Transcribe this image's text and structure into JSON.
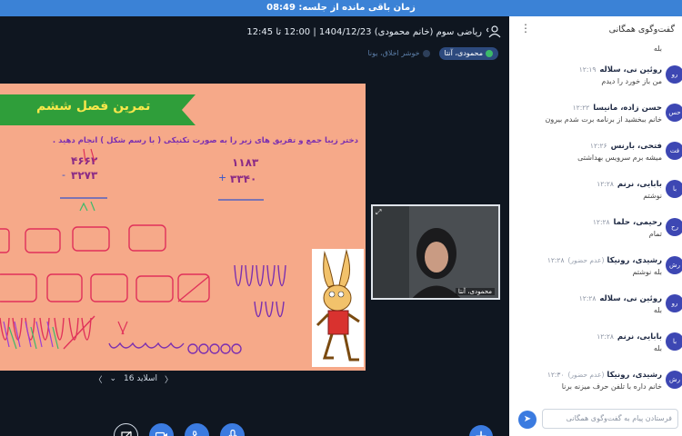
{
  "topbar": {
    "text": "زمان باقی مانده از جلسه: 08:49"
  },
  "session": {
    "title": "ریاضی سوم (خانم محمودی) 1404/12/23 | 12:00 تا 12:45",
    "user_icon": "user-settings-icon"
  },
  "chips": [
    {
      "label": "محمودی، آنتا",
      "state": "active",
      "icon": "mic-icon"
    },
    {
      "label": "خوشر اخلاق، یونا",
      "state": "muted",
      "icon": "avatar-icon"
    }
  ],
  "slide": {
    "banner": "تمرین فصل ششم",
    "instruction": "دختر زیبا جمع و تفریق های زیر را به صورت تکنیکی ( با رسم شکل ) انجام دهید .",
    "sub_top": "۴۶۶۲",
    "sub_bottom": "۳۲۷۳",
    "add_top": "۱۱۸۳",
    "add_bottom": "۳۳۴۰",
    "nav_label": "اسلاید 16"
  },
  "webcam": {
    "name": "محمودی، آنتا"
  },
  "chat": {
    "title": "گفت‌وگوی همگانی",
    "input_placeholder": "فرستادن پیام به گفت‌وگوی همگانی",
    "messages": [
      {
        "initials": "",
        "name": "",
        "time": "",
        "tag": "",
        "text": "بله"
      },
      {
        "initials": "رو",
        "name": "روئین نی، سلاله",
        "time": "۱۲:۱۹",
        "tag": "",
        "text": "من باز خورد را دیدم"
      },
      {
        "initials": "حس",
        "name": "حسن زاده، مانیسا",
        "time": "۱۲:۲۲",
        "tag": "",
        "text": "خانم ببخشید از برنامه برت شدم بیرون"
      },
      {
        "initials": "فت",
        "name": "فتحی، بارنس",
        "time": "۱۲:۲۶",
        "tag": "",
        "text": "میشه برم سرویس بهداشتی"
      },
      {
        "initials": "با",
        "name": "بابایی، نرنم",
        "time": "۱۲:۲۸",
        "tag": "",
        "text": "نوشتم"
      },
      {
        "initials": "رح",
        "name": "رحیمی، حلما",
        "time": "۱۲:۲۸",
        "tag": "",
        "text": "تمام"
      },
      {
        "initials": "رش",
        "name": "رشیدی، رونیکا",
        "time": "۱۲:۲۸",
        "tag": "(عدم حضور)",
        "text": "بله نوشتم"
      },
      {
        "initials": "رو",
        "name": "روئین نی، سلاله",
        "time": "۱۲:۲۸",
        "tag": "",
        "text": "بله"
      },
      {
        "initials": "با",
        "name": "بابایی، نرنم",
        "time": "۱۲:۲۸",
        "tag": "",
        "text": "بله"
      },
      {
        "initials": "رش",
        "name": "رشیدی، رونیکا",
        "time": "۱۲:۳۰",
        "tag": "(عدم حضور)",
        "text": "خانم داره با تلفن حرف میزنه برنا"
      }
    ]
  },
  "colors": {
    "accent": "#3b7be0",
    "slide_bg": "#f6a989",
    "banner": "#2f9e3a",
    "drawing": "#e0315a"
  }
}
